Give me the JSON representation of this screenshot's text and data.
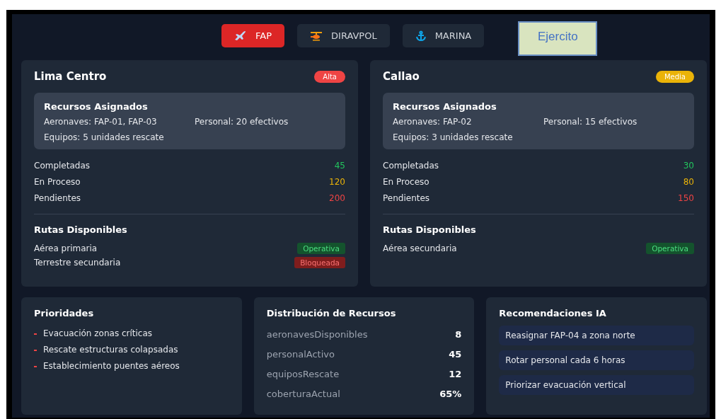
{
  "tabs": [
    {
      "label": "FAP",
      "kind": "plane",
      "selected": true
    },
    {
      "label": "DIRAVPOL",
      "kind": "helicopter",
      "selected": false
    },
    {
      "label": "MARINA",
      "kind": "anchor",
      "selected": false
    },
    {
      "label": "Ejercito",
      "kind": "plain",
      "selected": false
    }
  ],
  "zones": [
    {
      "name": "Lima Centro",
      "priority": {
        "label": "Alta",
        "kind": "high"
      },
      "resources_title": "Recursos Asignados",
      "aircraft": "Aeronaves: FAP-01, FAP-03",
      "personnel": "Personal: 20 efectivos",
      "equipment": "Equipos: 5 unidades rescate",
      "stats": [
        {
          "label": "Completadas",
          "value": "45",
          "kind": "done"
        },
        {
          "label": "En Proceso",
          "value": "120",
          "kind": "progress"
        },
        {
          "label": "Pendientes",
          "value": "200",
          "kind": "pending"
        }
      ],
      "routes_title": "Rutas Disponibles",
      "routes": [
        {
          "name": "Aérea primaria",
          "status": "Operativa",
          "kind": "ok"
        },
        {
          "name": "Terrestre secundaria",
          "status": "Bloqueada",
          "kind": "blocked"
        }
      ]
    },
    {
      "name": "Callao",
      "priority": {
        "label": "Media",
        "kind": "medium"
      },
      "resources_title": "Recursos Asignados",
      "aircraft": "Aeronaves: FAP-02",
      "personnel": "Personal: 15 efectivos",
      "equipment": "Equipos: 3 unidades rescate",
      "stats": [
        {
          "label": "Completadas",
          "value": "30",
          "kind": "done"
        },
        {
          "label": "En Proceso",
          "value": "80",
          "kind": "progress"
        },
        {
          "label": "Pendientes",
          "value": "150",
          "kind": "pending"
        }
      ],
      "routes_title": "Rutas Disponibles",
      "routes": [
        {
          "name": "Aérea secundaria",
          "status": "Operativa",
          "kind": "ok"
        }
      ]
    }
  ],
  "priorities": {
    "title": "Prioridades",
    "items": [
      "Evacuación zonas críticas",
      "Rescate estructuras colapsadas",
      "Establecimiento puentes aéreos"
    ]
  },
  "distribution": {
    "title": "Distribución de Recursos",
    "rows": [
      {
        "key": "aeronavesDisponibles",
        "value": "8"
      },
      {
        "key": "personalActivo",
        "value": "45"
      },
      {
        "key": "equiposRescate",
        "value": "12"
      },
      {
        "key": "coberturaActual",
        "value": "65%"
      }
    ]
  },
  "recommendations": {
    "title": "Recomendaciones IA",
    "items": [
      "Reasignar FAP-04 a zona norte",
      "Rotar personal cada 6 horas",
      "Priorizar evacuación vertical"
    ]
  }
}
